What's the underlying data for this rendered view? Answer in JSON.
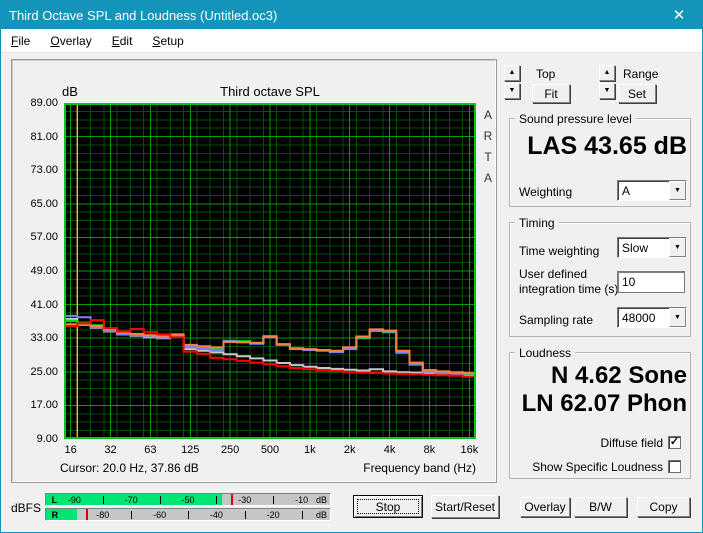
{
  "window": {
    "title": "Third Octave SPL and Loudness (Untitled.oc3)",
    "close_icon": "✕"
  },
  "menu": {
    "items": [
      {
        "accel": "F",
        "rest": "ile"
      },
      {
        "accel": "O",
        "rest": "verlay"
      },
      {
        "accel": "E",
        "rest": "dit"
      },
      {
        "accel": "S",
        "rest": "etup"
      }
    ]
  },
  "chart": {
    "unit_label": "dB",
    "title": "Third octave SPL",
    "watermark": "ARTA",
    "cursor_text": "Cursor:   20.0 Hz, 37.86 dB",
    "x_axis_label": "Frequency band (Hz)"
  },
  "chart_data": {
    "type": "line",
    "style": "third-octave-step",
    "title": "Third octave SPL",
    "ylabel": "dB",
    "xlabel": "Frequency band (Hz)",
    "ylim": [
      9,
      89
    ],
    "ytick_step": 8,
    "x_ticks": [
      "16",
      "32",
      "63",
      "125",
      "250",
      "500",
      "1k",
      "2k",
      "4k",
      "8k",
      "16k"
    ],
    "bands": [
      "16",
      "20",
      "25",
      "31.5",
      "40",
      "50",
      "63",
      "80",
      "100",
      "125",
      "160",
      "200",
      "250",
      "315",
      "400",
      "500",
      "630",
      "800",
      "1k",
      "1.25k",
      "1.6k",
      "2k",
      "2.5k",
      "3.15k",
      "4k",
      "5k",
      "6.3k",
      "8k",
      "10k",
      "12.5k",
      "16k"
    ],
    "cursor": {
      "band_index": 1,
      "frequency": "20.0 Hz",
      "value_db": 37.86
    },
    "grid": {
      "bg": "#000000",
      "minor": "#074d07",
      "major": "#0a9a0a",
      "border": "#00c61e",
      "cursor": "#c8c832"
    },
    "series": [
      {
        "name": "gray",
        "color": "#c8c8c8",
        "values": [
          37.6,
          36.2,
          35.5,
          34.6,
          33.9,
          33.6,
          33.2,
          33.0,
          33.4,
          30.4,
          30.0,
          29.6,
          29.2,
          28.7,
          28.2,
          27.7,
          27.1,
          26.6,
          26.2,
          25.9,
          25.7,
          25.5,
          25.3,
          25.6,
          25.1,
          24.9,
          24.8,
          24.7,
          24.5,
          24.3,
          24.2
        ]
      },
      {
        "name": "green",
        "color": "#00dc00",
        "values": [
          37.1,
          36.6,
          36.1,
          34.9,
          34.1,
          33.8,
          33.5,
          33.2,
          33.5,
          31.0,
          30.7,
          30.4,
          32.4,
          32.3,
          31.8,
          33.5,
          31.5,
          30.5,
          30.3,
          30.1,
          29.9,
          30.6,
          33.0,
          34.7,
          34.4,
          29.5,
          26.7,
          25.2,
          25.0,
          24.8,
          24.4
        ]
      },
      {
        "name": "blue",
        "color": "#8080ff",
        "values": [
          38.3,
          38.0,
          35.6,
          34.7,
          34.0,
          33.7,
          33.4,
          33.1,
          33.7,
          30.9,
          30.5,
          30.1,
          32.3,
          32.1,
          31.7,
          33.2,
          31.4,
          30.4,
          30.2,
          30.0,
          29.7,
          30.4,
          33.2,
          34.9,
          34.6,
          29.7,
          26.9,
          25.0,
          24.6,
          24.5,
          24.6
        ]
      },
      {
        "name": "orange",
        "color": "#ff8040",
        "values": [
          36.3,
          36.4,
          35.9,
          35.1,
          34.3,
          34.0,
          33.7,
          33.4,
          33.9,
          31.4,
          31.1,
          30.8,
          32.1,
          32.0,
          31.9,
          33.4,
          31.6,
          30.6,
          30.4,
          30.2,
          30.0,
          30.8,
          33.4,
          35.1,
          34.8,
          30.0,
          27.2,
          25.4,
          25.1,
          24.9,
          24.7
        ]
      },
      {
        "name": "red",
        "color": "#ff0000",
        "values": [
          35.9,
          36.5,
          37.3,
          35.4,
          34.6,
          35.2,
          34.4,
          33.9,
          33.2,
          29.8,
          29.3,
          28.3,
          28.0,
          27.6,
          27.2,
          26.8,
          26.3,
          25.9,
          25.6,
          25.4,
          25.2,
          24.9,
          24.8,
          24.7,
          24.6,
          24.5,
          24.4,
          24.3,
          24.2,
          24.1,
          23.8
        ]
      }
    ]
  },
  "nav": {
    "top_label": "Top",
    "fit_label": "Fit",
    "range_label": "Range",
    "set_label": "Set",
    "up_icon": "▲",
    "down_icon": "▼"
  },
  "spl": {
    "group_label": "Sound pressure level",
    "value": "LAS 43.65 dB",
    "weighting_label": "Weighting",
    "weighting_value": "A"
  },
  "timing": {
    "group_label": "Timing",
    "time_weighting_label": "Time weighting",
    "time_weighting_value": "Slow",
    "integration_label_line1": "User defined",
    "integration_label_line2": "integration time (s)",
    "integration_value": "10",
    "sampling_label": "Sampling rate",
    "sampling_value": "48000"
  },
  "loudness": {
    "group_label": "Loudness",
    "sone_value": "N 4.62 Sone",
    "phon_value": "LN 62.07 Phon",
    "diffuse_label": "Diffuse field",
    "diffuse_checked": true,
    "specific_label": "Show Specific Loudness",
    "specific_checked": false,
    "check_icon": "✓"
  },
  "meter": {
    "caption": "dBFS",
    "bar_color": "#00e673",
    "peak_color": "#dd0000",
    "channels": [
      {
        "label": "L",
        "tick_labels": [
          "-90",
          "-70",
          "-50",
          "-30",
          "-10"
        ],
        "label_start_pct": 10,
        "unit": "dB",
        "bar_pct": 62,
        "peak_pct": 65
      },
      {
        "label": "R",
        "tick_labels": [
          "-80",
          "-60",
          "-40",
          "-20"
        ],
        "label_start_pct": 20,
        "unit": "dB",
        "bar_pct": 11,
        "peak_pct": 14
      }
    ]
  },
  "buttons": {
    "stop": "Stop",
    "start_reset": "Start/Reset",
    "overlay": "Overlay",
    "bw": "B/W",
    "copy": "Copy"
  }
}
